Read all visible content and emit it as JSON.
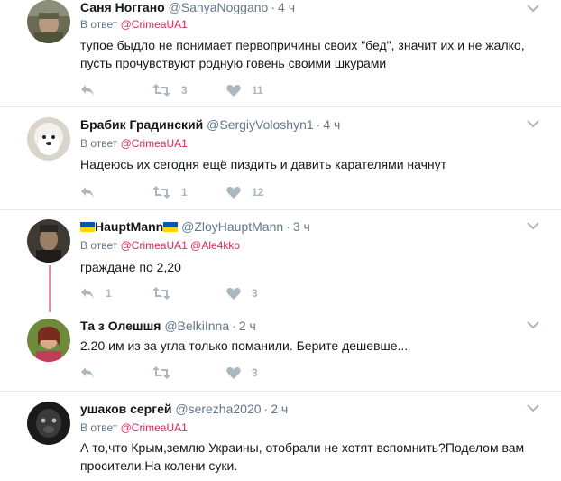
{
  "reply_prefix": "В ответ",
  "tweets": [
    {
      "name": "Саня Ногганo",
      "handle": "@SanyaNoggano",
      "time": "4 ч",
      "reply_to": "@CrimeaUA1",
      "reply_to_2": "",
      "text": "тупое быдло не понимает первопричины своих \"бед\", значит их и не жалко, пусть прочувствуют родную говень своими шкурами",
      "replies": "",
      "retweets": "3",
      "likes": "11"
    },
    {
      "name": "Брабик Градинский",
      "handle": "@SergiyVoloshyn1",
      "time": "4 ч",
      "reply_to": "@CrimeaUA1",
      "reply_to_2": "",
      "text": "Надеюсь их сегодня ещё пиздить и давить карателями начнут",
      "replies": "",
      "retweets": "1",
      "likes": "12"
    },
    {
      "name": "HauptMann",
      "handle": "@ZloyHauptMann",
      "time": "3 ч",
      "reply_to": "@CrimeaUA1",
      "reply_to_2": "@Ale4kko",
      "text": "граждане по 2,20",
      "replies": "1",
      "retweets": "",
      "likes": "3"
    },
    {
      "name": "Та з Олешшя",
      "handle": "@BelkiInna",
      "time": "2 ч",
      "reply_to": "",
      "reply_to_2": "",
      "text": "2.20 им из за угла только поманили. Берите дешевше...",
      "replies": "",
      "retweets": "",
      "likes": "3"
    },
    {
      "name": "ушаков сергей",
      "handle": "@serezha2020",
      "time": "2 ч",
      "reply_to": "@CrimeaUA1",
      "reply_to_2": "",
      "text": "А то,что Крым,землю Украины, отобрали не хотят вспомнить?Поделом вам просители.На колени суки.",
      "replies": "",
      "retweets": "",
      "likes": ""
    }
  ],
  "colors": {
    "name": "#14171a",
    "meta": "#657786",
    "mention": "#e0245e",
    "action": "#aab8c2",
    "separator": "#e6ecf0",
    "flag_blue": "#0057b7",
    "flag_yellow": "#ffd700"
  },
  "icons": [
    "reply-icon",
    "retweet-icon",
    "like-icon",
    "caret-down-icon",
    "ukraine-flag-icon"
  ]
}
